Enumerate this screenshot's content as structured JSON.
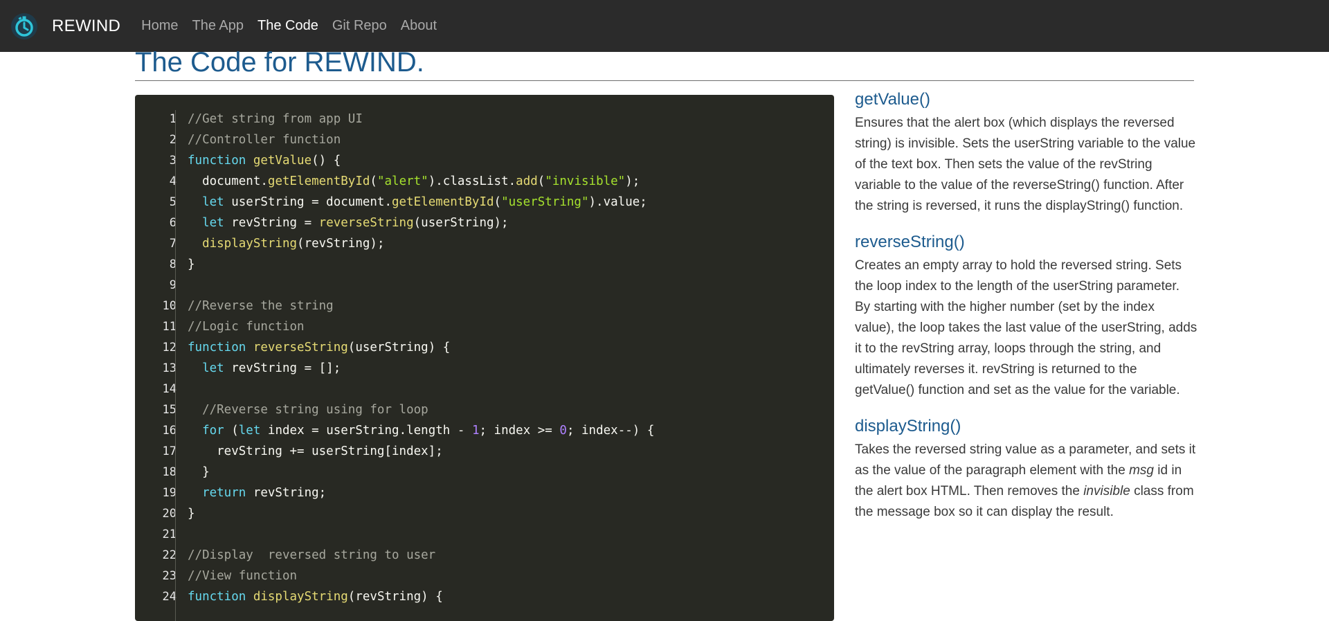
{
  "nav": {
    "brand": "REWIND",
    "logo_icon": "stopwatch-rewind-icon",
    "links": [
      "Home",
      "The App",
      "The Code",
      "Git Repo",
      "About"
    ],
    "active": "The Code"
  },
  "page": {
    "title": "The Code for REWIND."
  },
  "code": {
    "line_numbers": [
      "1",
      "2",
      "3",
      "4",
      "5",
      "6",
      "7",
      "8",
      "9",
      "10",
      "11",
      "12",
      "13",
      "14",
      "15",
      "16",
      "17",
      "18",
      "19",
      "20",
      "21",
      "22",
      "23",
      "24"
    ],
    "lines": [
      [
        [
          "c",
          "//Get string from app UI"
        ]
      ],
      [
        [
          "c",
          "//Controller function"
        ]
      ],
      [
        [
          "k",
          "function "
        ],
        [
          "f",
          "getValue"
        ],
        [
          "p",
          "() {"
        ]
      ],
      [
        [
          "p",
          "  document."
        ],
        [
          "f",
          "getElementById"
        ],
        [
          "p",
          "("
        ],
        [
          "s",
          "\"alert\""
        ],
        [
          "p",
          ").classList."
        ],
        [
          "f",
          "add"
        ],
        [
          "p",
          "("
        ],
        [
          "s",
          "\"invisible\""
        ],
        [
          "p",
          ");"
        ]
      ],
      [
        [
          "k",
          "  let "
        ],
        [
          "p",
          "userString = document."
        ],
        [
          "f",
          "getElementById"
        ],
        [
          "p",
          "("
        ],
        [
          "s",
          "\"userString\""
        ],
        [
          "p",
          ").value;"
        ]
      ],
      [
        [
          "k",
          "  let "
        ],
        [
          "p",
          "revString = "
        ],
        [
          "f",
          "reverseString"
        ],
        [
          "p",
          "(userString);"
        ]
      ],
      [
        [
          "f",
          "  displayString"
        ],
        [
          "p",
          "(revString);"
        ]
      ],
      [
        [
          "p",
          "}"
        ]
      ],
      [],
      [
        [
          "c",
          "//Reverse the string"
        ]
      ],
      [
        [
          "c",
          "//Logic function"
        ]
      ],
      [
        [
          "k",
          "function "
        ],
        [
          "f",
          "reverseString"
        ],
        [
          "p",
          "(userString) {"
        ]
      ],
      [
        [
          "k",
          "  let "
        ],
        [
          "p",
          "revString = [];"
        ]
      ],
      [],
      [
        [
          "c",
          "  //Reverse string using for loop"
        ]
      ],
      [
        [
          "k",
          "  for "
        ],
        [
          "p",
          "("
        ],
        [
          "k",
          "let "
        ],
        [
          "p",
          "index = userString.length - "
        ],
        [
          "n",
          "1"
        ],
        [
          "p",
          "; index >= "
        ],
        [
          "n",
          "0"
        ],
        [
          "p",
          "; index--) {"
        ]
      ],
      [
        [
          "p",
          "    revString += userString[index];"
        ]
      ],
      [
        [
          "p",
          "  }"
        ]
      ],
      [
        [
          "k",
          "  return "
        ],
        [
          "p",
          "revString;"
        ]
      ],
      [
        [
          "p",
          "}"
        ]
      ],
      [],
      [
        [
          "c",
          "//Display  reversed string to user"
        ]
      ],
      [
        [
          "c",
          "//View function"
        ]
      ],
      [
        [
          "k",
          "function "
        ],
        [
          "f",
          "displayString"
        ],
        [
          "p",
          "(revString) {"
        ]
      ]
    ]
  },
  "sections": [
    {
      "heading": "getValue()",
      "body": [
        {
          "t": "Ensures that the alert box (which displays the reversed string) is invisible. Sets the userString variable to the value of the text box. Then sets the value of the revString variable to the value of the reverseString() function. After the string is reversed, it runs the displayString() function."
        }
      ]
    },
    {
      "heading": "reverseString()",
      "body": [
        {
          "t": "Creates an empty array to hold the reversed string. Sets the loop index to the length of the userString parameter. By starting with the higher number (set by the index value), the loop takes the last value of the userString, adds it to the revString array, loops through the string, and ultimately reverses it. revString is returned to the getValue() function and set as the value for the variable."
        }
      ]
    },
    {
      "heading": "displayString()",
      "body": [
        {
          "t": "Takes the reversed string value as a parameter, and sets it as the value of the paragraph element with the "
        },
        {
          "t": "msg",
          "em": true
        },
        {
          "t": " id in the alert box HTML. Then removes the "
        },
        {
          "t": "invisible",
          "em": true
        },
        {
          "t": " class from the message box so it can display the result."
        }
      ]
    }
  ]
}
